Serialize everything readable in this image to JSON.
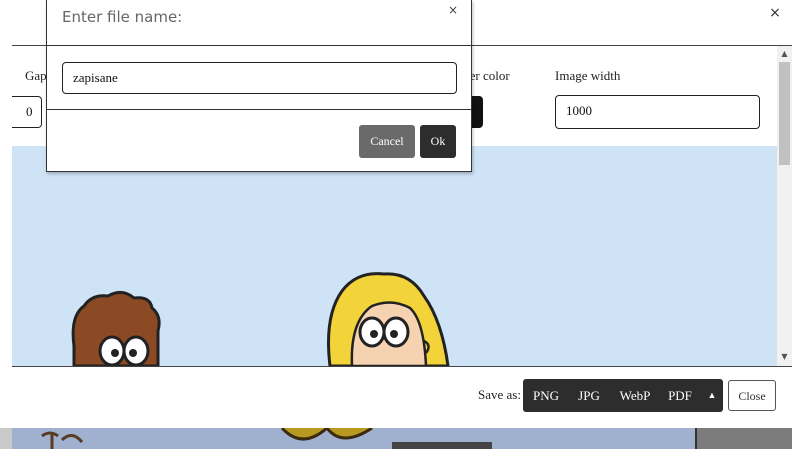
{
  "export_panel": {
    "close_icon": "×",
    "fields": {
      "gap_label": "Gap",
      "gap_value": "0",
      "border_color_label": "ler color",
      "border_color_value": "#111111",
      "image_width_label": "Image width",
      "image_width_value": "1000"
    },
    "scrollbar": {
      "up_icon": "▲",
      "down_icon": "▼"
    },
    "footer": {
      "save_as_label": "Save as:",
      "formats": [
        "PNG",
        "JPG",
        "WebP",
        "PDF"
      ],
      "more_icon": "▲",
      "close_label": "Close"
    }
  },
  "dialog": {
    "title": "Enter file name:",
    "close_icon": "×",
    "filename_value": "zapisane",
    "cancel_label": "Cancel",
    "ok_label": "Ok"
  },
  "colors": {
    "preview_background": "#cfe3f7",
    "button_dark": "#2d2d2d",
    "button_gray": "#6a6a6a"
  }
}
